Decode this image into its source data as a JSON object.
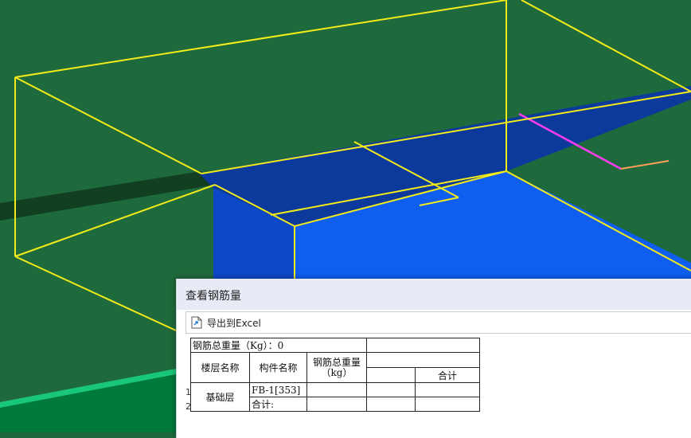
{
  "dialog": {
    "title": "查看钢筋量",
    "export_label": "导出到Excel",
    "export_icon": "export-excel-icon"
  },
  "table": {
    "total_weight_label": "钢筋总重量（Kg）：0",
    "col_floor": "楼层名称",
    "col_component": "构件名称",
    "col_total_line1": "钢筋总重量",
    "col_total_line2": "（kg）",
    "col_sum": "合计",
    "floor_value": "基础层",
    "row1_component": "FB-1[353]",
    "row2_component": "合计:"
  },
  "row_numbers": [
    "1",
    "2"
  ],
  "colors": {
    "background_green": "#1f6a3c",
    "wireframe_yellow": "#f4ec1a",
    "slab_blue_dark": "#0b3a9c",
    "slab_blue_light": "#0f5ef0",
    "magenta_edge": "#ff3cf0",
    "dialog_title_bg": "#e8ebf6"
  }
}
